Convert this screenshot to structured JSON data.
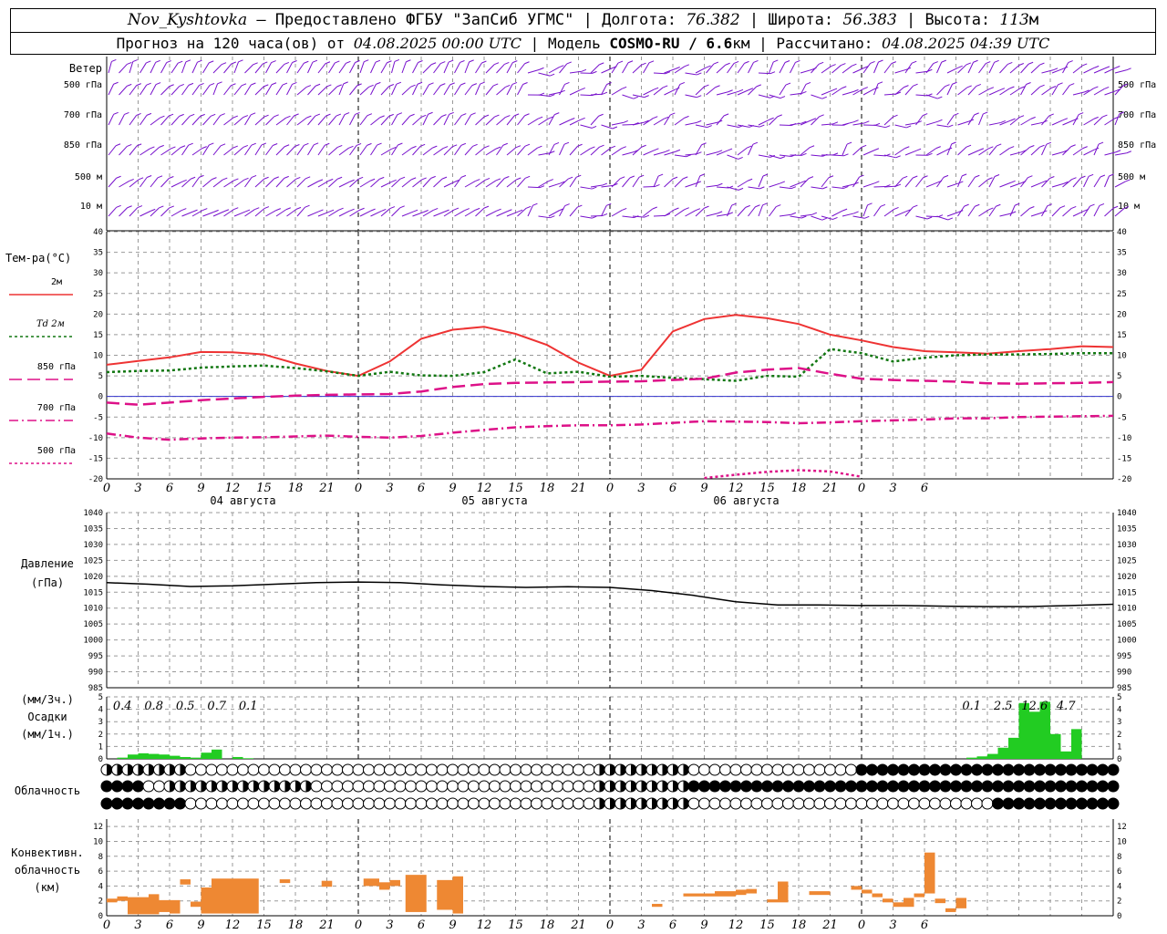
{
  "header": {
    "station": "Nov_Kyshtovka",
    "provider": "— Предоставлено ФГБУ \"ЗапСиб УГМС\"",
    "lon_label": "Долгота:",
    "lon": "76.382",
    "lat_label": "Широта:",
    "lat": "56.383",
    "alt_label": "Высота:",
    "alt": "113",
    "alt_unit": "м",
    "forecast_label": "Прогноз на 120 часа(ов) от",
    "forecast_start": "04.08.2025 00:00 UTC",
    "model_label": "Модель",
    "model": "COSMO-RU / 6.6",
    "model_unit": "км",
    "calc_label": "Рассчитано:",
    "calc_time": "04.08.2025 04:39 UTC"
  },
  "panels": {
    "wind_title": "Ветер",
    "wind_levels": [
      "500 гПа",
      "700 гПа",
      "850 гПа",
      "500 м",
      "10  м"
    ],
    "temp_title": "Тем-ра(°С)",
    "temp_legend": [
      {
        "label": "2м",
        "color": "#ee3333",
        "dash": "none"
      },
      {
        "label": "Td  2м",
        "color": "#117711",
        "dash": "3,3"
      },
      {
        "label": "850 гПа",
        "color": "#dd1188",
        "dash": "14,6"
      },
      {
        "label": "700 гПа",
        "color": "#dd1188",
        "dash": "10,4,2,4"
      },
      {
        "label": "500 гПа",
        "color": "#dd1188",
        "dash": "3,3"
      }
    ],
    "pressure_title": "Давление",
    "pressure_unit": "(гПа)",
    "precip_title": [
      "(мм/3ч.)",
      "Осадки",
      "(мм/1ч.)"
    ],
    "cloud_title": "Облачность",
    "conv_title": [
      "Конвективн.",
      "облачность",
      "(км)"
    ]
  },
  "chart_data": [
    {
      "type": "line",
      "name": "temperature",
      "x_hours": [
        0,
        3,
        6,
        9,
        12,
        15,
        18,
        21,
        24,
        27,
        30,
        33,
        36,
        39,
        42,
        45,
        48,
        51,
        54,
        57,
        60,
        63,
        66,
        69,
        72,
        75,
        78,
        81,
        84,
        87,
        90,
        93,
        96
      ],
      "ylim": [
        -20,
        40
      ],
      "yticks": [
        -20,
        -15,
        -10,
        -5,
        0,
        5,
        10,
        15,
        20,
        25,
        30,
        35,
        40
      ],
      "xtick_labels": [
        "0",
        "3",
        "6",
        "9",
        "12",
        "15",
        "18",
        "21",
        "0",
        "3",
        "6",
        "9",
        "12",
        "15",
        "18",
        "21",
        "0",
        "3",
        "6",
        "9",
        "12",
        "15",
        "18",
        "21",
        "0",
        "3",
        "6"
      ],
      "day_labels": [
        "04 августа",
        "05 августа",
        "06 августа"
      ],
      "series": [
        {
          "name": "2м",
          "values": [
            7.7,
            8.6,
            9.5,
            10.8,
            10.7,
            10.2,
            8.0,
            6.2,
            5.0,
            8.5,
            14.0,
            16.2,
            16.9,
            15.2,
            12.5,
            8.2,
            5.0,
            6.5,
            15.8,
            18.8,
            19.8,
            19.0,
            17.6,
            15.0,
            13.6,
            12.0,
            11.0,
            10.7,
            10.4,
            11.0,
            11.5,
            12.2,
            12.0
          ]
        },
        {
          "name": "Td  2м",
          "values": [
            5.9,
            6.2,
            6.3,
            7.0,
            7.3,
            7.5,
            6.9,
            6.1,
            5.0,
            6.0,
            5.1,
            5.0,
            5.9,
            9.0,
            5.6,
            6.0,
            4.8,
            5.0,
            4.5,
            4.2,
            3.8,
            5.0,
            4.8,
            11.5,
            10.5,
            8.5,
            9.4,
            10.0,
            10.2,
            10.2,
            10.3,
            10.5,
            10.5
          ]
        },
        {
          "name": "850 гПа",
          "values": [
            -1.5,
            -2.0,
            -1.5,
            -0.9,
            -0.5,
            -0.1,
            0.2,
            0.4,
            0.5,
            0.6,
            1.2,
            2.3,
            3.0,
            3.3,
            3.4,
            3.5,
            3.6,
            3.7,
            4.0,
            4.3,
            5.8,
            6.5,
            6.9,
            5.5,
            4.3,
            4.0,
            3.8,
            3.6,
            3.2,
            3.1,
            3.2,
            3.3,
            3.5
          ]
        },
        {
          "name": "700 гПа",
          "values": [
            -9.0,
            -10.0,
            -10.5,
            -10.2,
            -10.0,
            -9.9,
            -9.7,
            -9.5,
            -9.8,
            -10.0,
            -9.6,
            -8.8,
            -8.1,
            -7.5,
            -7.2,
            -7.0,
            -7.0,
            -6.8,
            -6.4,
            -6.0,
            -6.1,
            -6.2,
            -6.5,
            -6.3,
            -6.0,
            -5.8,
            -5.6,
            -5.3,
            -5.3,
            -5.0,
            -4.9,
            -4.8,
            -4.7
          ]
        },
        {
          "name": "500 гПа",
          "values": [
            null,
            null,
            null,
            null,
            null,
            null,
            null,
            null,
            null,
            null,
            null,
            null,
            null,
            null,
            null,
            null,
            null,
            null,
            null,
            -19.8,
            -19.0,
            -18.3,
            -17.9,
            -18.2,
            -19.5,
            null,
            null,
            null,
            null,
            null,
            null,
            null,
            null
          ]
        }
      ]
    },
    {
      "type": "line",
      "name": "pressure",
      "ylim": [
        985,
        1040
      ],
      "yticks": [
        985,
        990,
        995,
        1000,
        1005,
        1010,
        1015,
        1020,
        1025,
        1030,
        1035,
        1040
      ],
      "x_hours": [
        0,
        4,
        8,
        12,
        16,
        20,
        24,
        28,
        32,
        36,
        40,
        44,
        48,
        52,
        56,
        60,
        64,
        68,
        72,
        76,
        80,
        84,
        88,
        92,
        96
      ],
      "values": [
        1018,
        1017.5,
        1016.8,
        1017,
        1017.5,
        1018,
        1018.2,
        1018,
        1017.3,
        1016.8,
        1016.5,
        1016.7,
        1016.5,
        1015.5,
        1014,
        1012,
        1011,
        1011,
        1010.8,
        1010.8,
        1010.6,
        1010.5,
        1010.5,
        1010.8,
        1011.2
      ]
    },
    {
      "type": "bar",
      "name": "precipitation",
      "ylim": [
        0,
        5
      ],
      "yticks": [
        0,
        1,
        2,
        3,
        4,
        5
      ],
      "labels": [
        {
          "hour": 1.5,
          "text": "0.4"
        },
        {
          "hour": 4.5,
          "text": "0.8"
        },
        {
          "hour": 7.5,
          "text": "0.5"
        },
        {
          "hour": 10.5,
          "text": "0.7"
        },
        {
          "hour": 13.5,
          "text": "0.1"
        },
        {
          "hour": 82.5,
          "text": "0.1"
        },
        {
          "hour": 85.5,
          "text": "2.5"
        },
        {
          "hour": 88.5,
          "text": "12.6"
        },
        {
          "hour": 91.5,
          "text": "4.7"
        }
      ],
      "bars": [
        {
          "start": 1,
          "value": 0.1
        },
        {
          "start": 2,
          "value": 0.35
        },
        {
          "start": 3,
          "value": 0.45
        },
        {
          "start": 4,
          "value": 0.4
        },
        {
          "start": 5,
          "value": 0.35
        },
        {
          "start": 6,
          "value": 0.25
        },
        {
          "start": 7,
          "value": 0.15
        },
        {
          "start": 8,
          "value": 0.1
        },
        {
          "start": 9,
          "value": 0.5
        },
        {
          "start": 10,
          "value": 0.75
        },
        {
          "start": 12,
          "value": 0.15
        },
        {
          "start": 13,
          "value": 0.05
        },
        {
          "start": 82,
          "value": 0.1
        },
        {
          "start": 83,
          "value": 0.2
        },
        {
          "start": 84,
          "value": 0.4
        },
        {
          "start": 85,
          "value": 0.9
        },
        {
          "start": 86,
          "value": 1.7
        },
        {
          "start": 87,
          "value": 4.5
        },
        {
          "start": 88,
          "value": 3.8
        },
        {
          "start": 89,
          "value": 4.6
        },
        {
          "start": 90,
          "value": 2.0
        },
        {
          "start": 91,
          "value": 0.6
        },
        {
          "start": 92,
          "value": 2.4
        }
      ]
    },
    {
      "type": "bar",
      "name": "convective_cloud",
      "ylim": [
        0,
        13
      ],
      "yticks": [
        0,
        2,
        4,
        6,
        8,
        10,
        12
      ],
      "bars": [
        {
          "start": 0,
          "end": 1,
          "low": 1.8,
          "high": 2.3
        },
        {
          "start": 1,
          "end": 2,
          "low": 2.0,
          "high": 2.6
        },
        {
          "start": 2,
          "end": 4,
          "low": 0.2,
          "high": 2.5
        },
        {
          "start": 4,
          "end": 5,
          "low": 0.2,
          "high": 2.9
        },
        {
          "start": 5,
          "end": 6,
          "low": 0.5,
          "high": 2.1
        },
        {
          "start": 6,
          "end": 7,
          "low": 0.3,
          "high": 2.1
        },
        {
          "start": 7,
          "end": 8,
          "low": 4.2,
          "high": 4.9
        },
        {
          "start": 8,
          "end": 9,
          "low": 1.2,
          "high": 1.9
        },
        {
          "start": 9,
          "end": 10,
          "low": 0.3,
          "high": 3.8
        },
        {
          "start": 10,
          "end": 14.5,
          "low": 0.3,
          "high": 5.0
        },
        {
          "start": 16.5,
          "end": 17.5,
          "low": 4.4,
          "high": 4.9
        },
        {
          "start": 20.5,
          "end": 21.5,
          "low": 3.9,
          "high": 4.7
        },
        {
          "start": 24.5,
          "end": 26,
          "low": 4.0,
          "high": 5.0
        },
        {
          "start": 26,
          "end": 27,
          "low": 3.5,
          "high": 4.5
        },
        {
          "start": 27,
          "end": 28,
          "low": 4.0,
          "high": 4.8
        },
        {
          "start": 28.5,
          "end": 30,
          "low": 0.5,
          "high": 5.5
        },
        {
          "start": 30,
          "end": 30.5,
          "low": 0.5,
          "high": 5.5
        },
        {
          "start": 31.5,
          "end": 33,
          "low": 0.8,
          "high": 4.8
        },
        {
          "start": 33,
          "end": 34,
          "low": 0.3,
          "high": 5.3
        },
        {
          "start": 52,
          "end": 53,
          "low": 1.2,
          "high": 1.6
        },
        {
          "start": 55,
          "end": 58,
          "low": 2.6,
          "high": 3.0
        },
        {
          "start": 58,
          "end": 60,
          "low": 2.6,
          "high": 3.3
        },
        {
          "start": 60,
          "end": 61,
          "low": 2.8,
          "high": 3.5
        },
        {
          "start": 61,
          "end": 62,
          "low": 3.0,
          "high": 3.6
        },
        {
          "start": 63,
          "end": 64,
          "low": 1.8,
          "high": 2.2
        },
        {
          "start": 64,
          "end": 65,
          "low": 1.8,
          "high": 4.6
        },
        {
          "start": 67,
          "end": 69,
          "low": 2.8,
          "high": 3.3
        },
        {
          "start": 71,
          "end": 72,
          "low": 3.5,
          "high": 4.0
        },
        {
          "start": 72,
          "end": 73,
          "low": 3.0,
          "high": 3.5
        },
        {
          "start": 73,
          "end": 74,
          "low": 2.5,
          "high": 3.0
        },
        {
          "start": 74,
          "end": 75,
          "low": 1.8,
          "high": 2.3
        },
        {
          "start": 75,
          "end": 76,
          "low": 1.2,
          "high": 1.8
        },
        {
          "start": 76,
          "end": 77,
          "low": 1.2,
          "high": 2.4
        },
        {
          "start": 77,
          "end": 78,
          "low": 2.5,
          "high": 3.0
        },
        {
          "start": 78,
          "end": 79,
          "low": 3.0,
          "high": 8.5
        },
        {
          "start": 79,
          "end": 80,
          "low": 1.7,
          "high": 2.3
        },
        {
          "start": 80,
          "end": 81,
          "low": 0.5,
          "high": 1.0
        },
        {
          "start": 81,
          "end": 82,
          "low": 1.0,
          "high": 2.4
        }
      ]
    }
  ],
  "colors": {
    "wind": "#7711cc",
    "temp2m": "#ee3333",
    "dew": "#117711",
    "upper": "#dd1188",
    "pressure": "#000000",
    "precip": "#22cc22",
    "conv": "#ee8833",
    "grid": "#999999"
  }
}
